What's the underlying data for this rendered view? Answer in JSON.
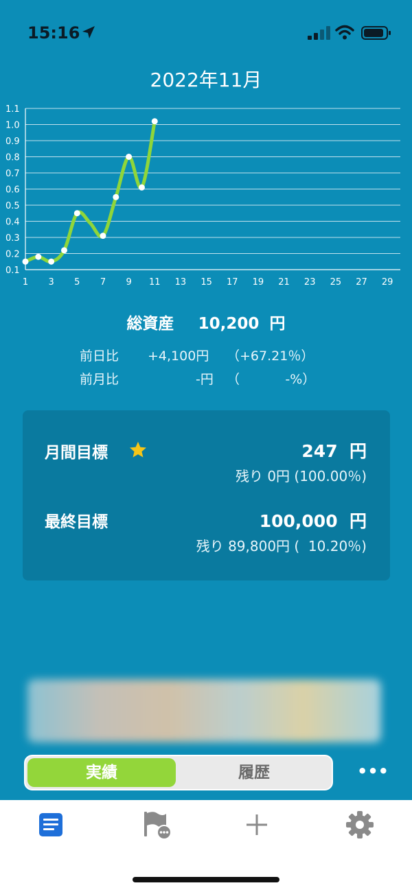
{
  "status_bar": {
    "time": "15:16"
  },
  "header": {
    "month": "2022年11月"
  },
  "chart_data": {
    "type": "line",
    "x": [
      1,
      2,
      3,
      4,
      5,
      6,
      7,
      8,
      9,
      10,
      11
    ],
    "series": [
      {
        "values": [
          0.15,
          0.18,
          0.15,
          0.22,
          0.45,
          0.39,
          0.31,
          0.55,
          0.8,
          0.61,
          1.02
        ]
      }
    ],
    "xlim": [
      1,
      30
    ],
    "ylim": [
      0.1,
      1.1
    ],
    "x_ticks": [
      "1",
      "3",
      "5",
      "7",
      "9",
      "11",
      "13",
      "15",
      "17",
      "19",
      "21",
      "23",
      "25",
      "27",
      "29"
    ],
    "y_ticks": [
      "0.1",
      "0.2",
      "0.3",
      "0.4",
      "0.5",
      "0.6",
      "0.7",
      "0.8",
      "0.9",
      "1.0",
      "1.1"
    ],
    "marked_x": [
      1,
      2,
      3,
      4,
      5,
      7,
      8,
      9,
      10,
      11
    ],
    "grid": true,
    "line_color": "#8fd63a",
    "marker_color": "#ffffff"
  },
  "assets": {
    "label": "総資産",
    "value": "10,200",
    "unit": "円"
  },
  "comparison": {
    "daily": {
      "label": "前日比",
      "amount": "+4,100円",
      "percent": "（+67.21％）"
    },
    "monthly": {
      "label": "前月比",
      "amount": "-円",
      "percent": "（           -%）"
    }
  },
  "goals": {
    "monthly": {
      "label": "月間目標",
      "value": "247  円",
      "remaining": "残り 0円 (100.00％)"
    },
    "final": {
      "label": "最終目標",
      "value": "100,000  円",
      "remaining": "残り 89,800円 (  10.20％)"
    }
  },
  "segment": {
    "active": "実績",
    "inactive": "履歴"
  },
  "more_label": "•••",
  "tabs": [
    {
      "icon": "document-icon",
      "active": true
    },
    {
      "icon": "flag-chat-icon",
      "active": false
    },
    {
      "icon": "plus-icon",
      "active": false
    },
    {
      "icon": "gear-icon",
      "active": false
    }
  ],
  "colors": {
    "background": "#0c8db7",
    "accent_green": "#93d63a",
    "star": "#f5c518",
    "tab_active": "#1e6fd9",
    "tab_inactive": "#8a8a8a"
  }
}
